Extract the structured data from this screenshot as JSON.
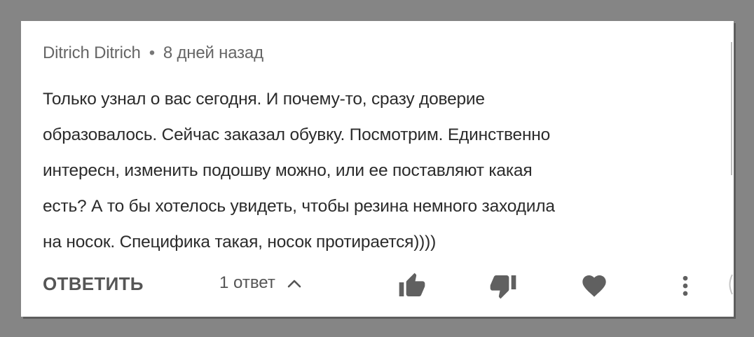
{
  "comment": {
    "author": "Ditrich Ditrich",
    "separator": "•",
    "time": "8 дней назад",
    "lines": [
      "Только узнал о вас сегодня. И почему-то, сразу доверие",
      "образовалось. Сейчас заказал обувку. Посмотрим. Единственно",
      "интересн, изменить подошву можно, или ее поставляют какая",
      "есть? А то бы хотелось увидеть, чтобы резина немного заходила",
      "на носок. Специфика такая, носок протирается))))"
    ]
  },
  "actions": {
    "reply_label": "ОТВЕТИТЬ",
    "replies_label": "1 ответ",
    "icons": {
      "replies_toggle": "chevron-up-icon",
      "like": "thumbs-up-icon",
      "dislike": "thumbs-down-icon",
      "heart": "heart-icon",
      "more": "more-vertical-icon"
    }
  },
  "colors": {
    "frame": "#858585",
    "card": "#ffffff",
    "meta_text": "#666666",
    "body_text": "#2b2b2b",
    "icon": "#606060"
  }
}
